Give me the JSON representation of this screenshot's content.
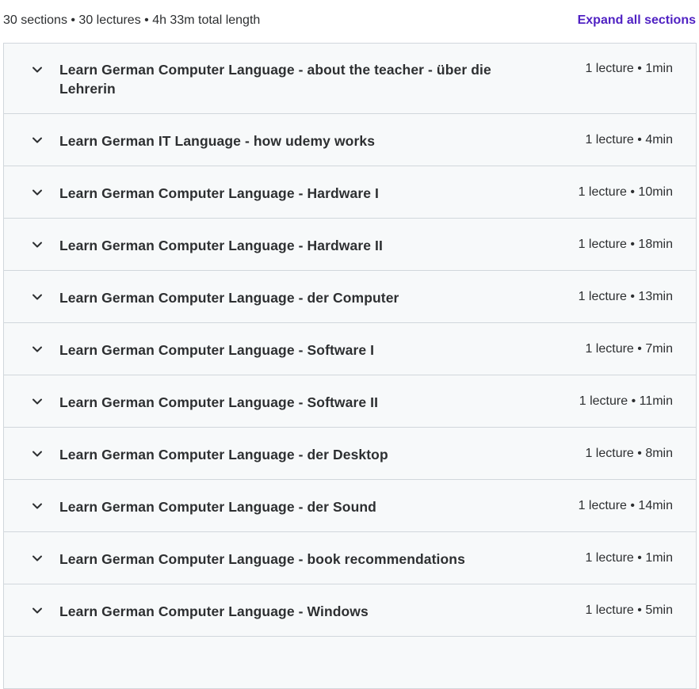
{
  "summary": {
    "text": "30 sections • 30 lectures • 4h 33m total length",
    "expand_label": "Expand all sections"
  },
  "icons": {
    "chevron": "chevron-down-icon"
  },
  "colors": {
    "accent": "#5022c3",
    "row_background": "#f7f9fa",
    "border": "#d1d7dc",
    "text": "#2d2f31"
  },
  "sections": [
    {
      "title": "Learn German Computer Language - about the teacher - über die Lehrerin",
      "meta": "1 lecture • 1min"
    },
    {
      "title": "Learn German IT Language - how udemy works",
      "meta": "1 lecture • 4min"
    },
    {
      "title": "Learn German Computer Language - Hardware I",
      "meta": "1 lecture • 10min"
    },
    {
      "title": "Learn German Computer Language - Hardware II",
      "meta": "1 lecture • 18min"
    },
    {
      "title": "Learn German Computer Language - der Computer",
      "meta": "1 lecture • 13min"
    },
    {
      "title": "Learn German Computer Language - Software I",
      "meta": "1 lecture • 7min"
    },
    {
      "title": "Learn German Computer Language - Software II",
      "meta": "1 lecture • 11min"
    },
    {
      "title": "Learn German Computer Language - der Desktop",
      "meta": "1 lecture • 8min"
    },
    {
      "title": "Learn German Computer Language - der Sound",
      "meta": "1 lecture • 14min"
    },
    {
      "title": "Learn German Computer Language - book recommendations",
      "meta": "1 lecture • 1min"
    },
    {
      "title": "Learn German Computer Language - Windows",
      "meta": "1 lecture • 5min"
    },
    {
      "title": "",
      "meta": ""
    }
  ]
}
